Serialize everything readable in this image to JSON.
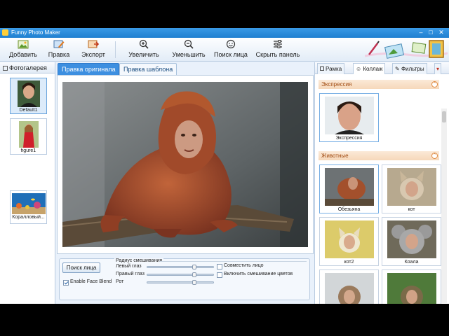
{
  "window": {
    "title": "Funny Photo Maker",
    "controls": {
      "minimize": "–",
      "maximize": "□",
      "close": "✕"
    }
  },
  "toolbar": {
    "items": [
      {
        "label": "Добавить",
        "icon": "add-photo-icon"
      },
      {
        "label": "Правка",
        "icon": "edit-icon"
      },
      {
        "label": "Экспорт",
        "icon": "export-icon"
      },
      {
        "label": "Увеличить",
        "icon": "zoom-in-icon"
      },
      {
        "label": "Уменьшить",
        "icon": "zoom-out-icon"
      },
      {
        "label": "Поиск лица",
        "icon": "face-search-icon"
      },
      {
        "label": "Скрыть панель",
        "icon": "hide-panel-icon"
      }
    ]
  },
  "gallery": {
    "title": "Фотогалерея",
    "items": [
      {
        "caption": "Default1",
        "selected": true
      },
      {
        "caption": "figure1",
        "selected": false
      },
      {
        "caption": "Коралловый...",
        "selected": false
      }
    ]
  },
  "editor": {
    "tabs": [
      {
        "label": "Правка оригинала",
        "active": true
      },
      {
        "label": "Правка шаблона",
        "active": false
      }
    ],
    "face_search_button": "Поиск лица",
    "blend_radius_title": "Радиус смешивания",
    "sliders": [
      {
        "label": "Левый глаз",
        "value": 0.7
      },
      {
        "label": "Правый глаз",
        "value": 0.7
      },
      {
        "label": "Рот",
        "value": 0.7
      }
    ],
    "enable_face_blend": {
      "label": "Enable Face Blend",
      "checked": true
    },
    "align_face": {
      "label": "Совместить лицо",
      "checked": false
    },
    "blend_colors": {
      "label": "Включить смешивание цветов",
      "checked": false
    }
  },
  "right_panel": {
    "tabs": [
      {
        "label": "Рамка",
        "active": false
      },
      {
        "label": "Коллаж",
        "active": true
      },
      {
        "label": "Фильтры",
        "active": false
      }
    ],
    "categories": [
      {
        "title": "Экспрессия",
        "items": [
          {
            "caption": "Экспрессия"
          }
        ]
      },
      {
        "title": "Животные",
        "items": [
          {
            "caption": "Обезьяна"
          },
          {
            "caption": "кот"
          },
          {
            "caption": "кот2"
          },
          {
            "caption": "Коала"
          },
          {
            "caption": ""
          },
          {
            "caption": ""
          }
        ]
      }
    ]
  },
  "colors": {
    "titlebar": "#1f7fd0",
    "active_tab": "#3d8fe0",
    "category_text": "#a04a10"
  }
}
